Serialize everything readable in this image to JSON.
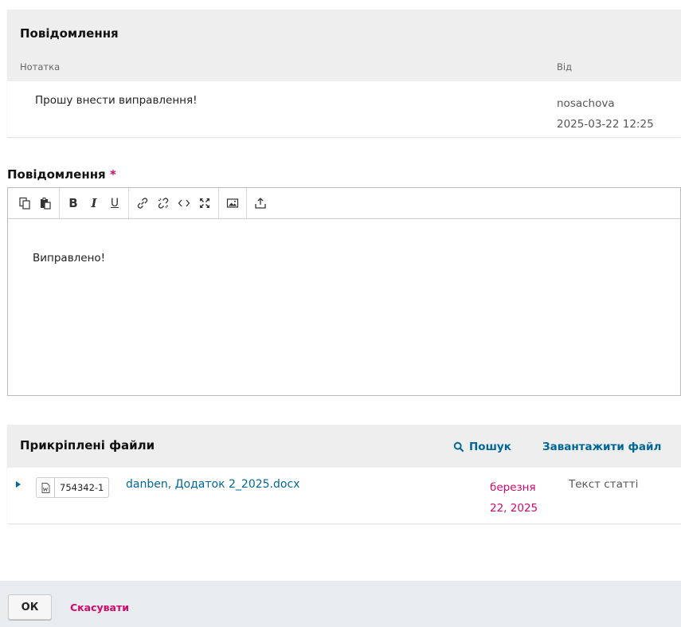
{
  "notes": {
    "title": "Повідомлення",
    "col_note": "Нотатка",
    "col_from": "Від",
    "rows": [
      {
        "text": "Прошу внести виправлення!",
        "user": "nosachova",
        "datetime": "2025-03-22 12:25"
      }
    ]
  },
  "message": {
    "label": "Повідомлення",
    "required_mark": "*",
    "body": "Виправлено!",
    "toolbar_icons": [
      "copy-icon",
      "paste-icon",
      "bold-icon",
      "italic-icon",
      "underline-icon",
      "link-icon",
      "unlink-icon",
      "code-icon",
      "fullscreen-icon",
      "image-icon",
      "upload-icon"
    ]
  },
  "attachments": {
    "title": "Прикріплені файли",
    "search_label": "Пошук",
    "upload_label": "Завантажити файл",
    "files": [
      {
        "id": "754342-1",
        "name": "danben, Додаток 2_2025.docx",
        "date_line1": "березня",
        "date_line2": "22, 2025",
        "type": "Текст статті"
      }
    ]
  },
  "footer": {
    "ok_label": "ОК",
    "cancel_label": "Скасувати"
  },
  "colors": {
    "link": "#006798",
    "accent": "#d00a6c",
    "panel_header": "#eeeeee"
  }
}
